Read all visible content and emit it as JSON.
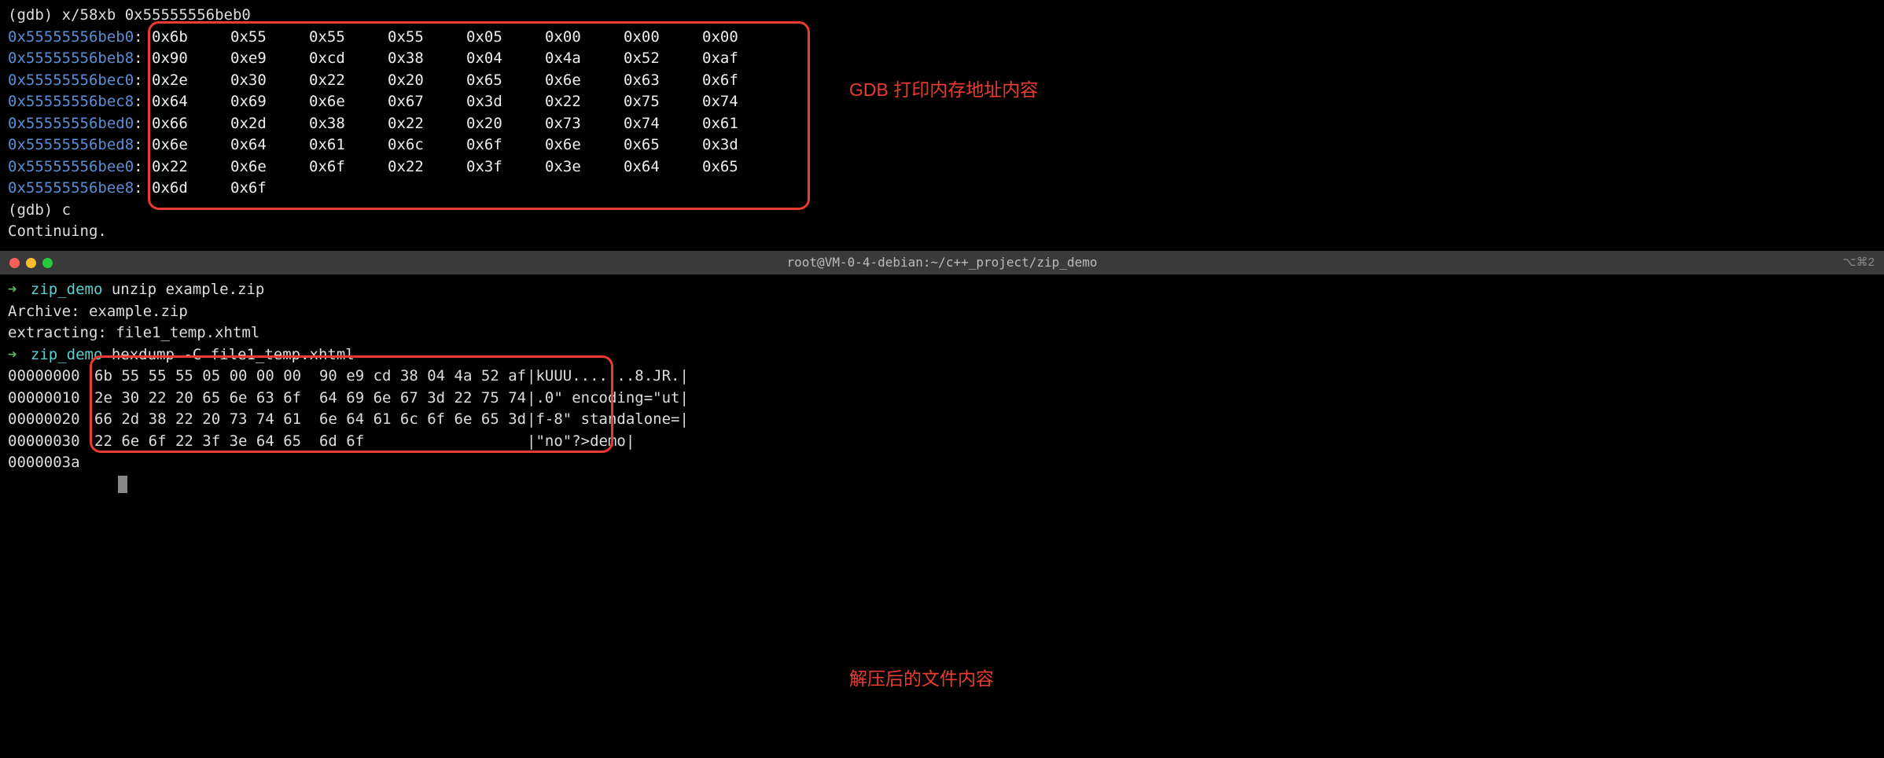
{
  "gdb_cmd": "(gdb) x/58xb 0x55555556beb0",
  "mem_rows": [
    {
      "addr": "0x55555556beb0",
      "bytes": [
        "0x6b",
        "0x55",
        "0x55",
        "0x55",
        "0x05",
        "0x00",
        "0x00",
        "0x00"
      ]
    },
    {
      "addr": "0x55555556beb8",
      "bytes": [
        "0x90",
        "0xe9",
        "0xcd",
        "0x38",
        "0x04",
        "0x4a",
        "0x52",
        "0xaf"
      ]
    },
    {
      "addr": "0x55555556bec0",
      "bytes": [
        "0x2e",
        "0x30",
        "0x22",
        "0x20",
        "0x65",
        "0x6e",
        "0x63",
        "0x6f"
      ]
    },
    {
      "addr": "0x55555556bec8",
      "bytes": [
        "0x64",
        "0x69",
        "0x6e",
        "0x67",
        "0x3d",
        "0x22",
        "0x75",
        "0x74"
      ]
    },
    {
      "addr": "0x55555556bed0",
      "bytes": [
        "0x66",
        "0x2d",
        "0x38",
        "0x22",
        "0x20",
        "0x73",
        "0x74",
        "0x61"
      ]
    },
    {
      "addr": "0x55555556bed8",
      "bytes": [
        "0x6e",
        "0x64",
        "0x61",
        "0x6c",
        "0x6f",
        "0x6e",
        "0x65",
        "0x3d"
      ]
    },
    {
      "addr": "0x55555556bee0",
      "bytes": [
        "0x22",
        "0x6e",
        "0x6f",
        "0x22",
        "0x3f",
        "0x3e",
        "0x64",
        "0x65"
      ]
    },
    {
      "addr": "0x55555556bee8",
      "bytes": [
        "0x6d",
        "0x6f"
      ]
    }
  ],
  "gdb_cont": "(gdb) c",
  "continuing": "Continuing.",
  "annotation1": "GDB 打印内存地址内容",
  "annotation2": "解压后的文件内容",
  "titlebar": {
    "title": "root@VM-0-4-debian:~/c++_project/zip_demo",
    "right": "⌥⌘2"
  },
  "cmd1_prefix": "zip_demo",
  "cmd1_rest": " unzip example.zip",
  "archive_line": "Archive:  example.zip",
  "extract_line": " extracting: file1_temp.xhtml",
  "cmd2_prefix": "zip_demo",
  "cmd2_rest": " hexdump -C file1_temp.xhtml",
  "hexdump": [
    {
      "off": "00000000",
      "hex": "6b 55 55 55 05 00 00 00  90 e9 cd 38 04 4a 52 af",
      "ascii": "|kUUU.......8.JR.|"
    },
    {
      "off": "00000010",
      "hex": "2e 30 22 20 65 6e 63 6f  64 69 6e 67 3d 22 75 74",
      "ascii": "|.0\" encoding=\"ut|"
    },
    {
      "off": "00000020",
      "hex": "66 2d 38 22 20 73 74 61  6e 64 61 6c 6f 6e 65 3d",
      "ascii": "|f-8\" standalone=|"
    },
    {
      "off": "00000030",
      "hex": "22 6e 6f 22 3f 3e 64 65  6d 6f",
      "ascii": "|\"no\"?>demo|"
    }
  ],
  "hexdump_end": "0000003a"
}
